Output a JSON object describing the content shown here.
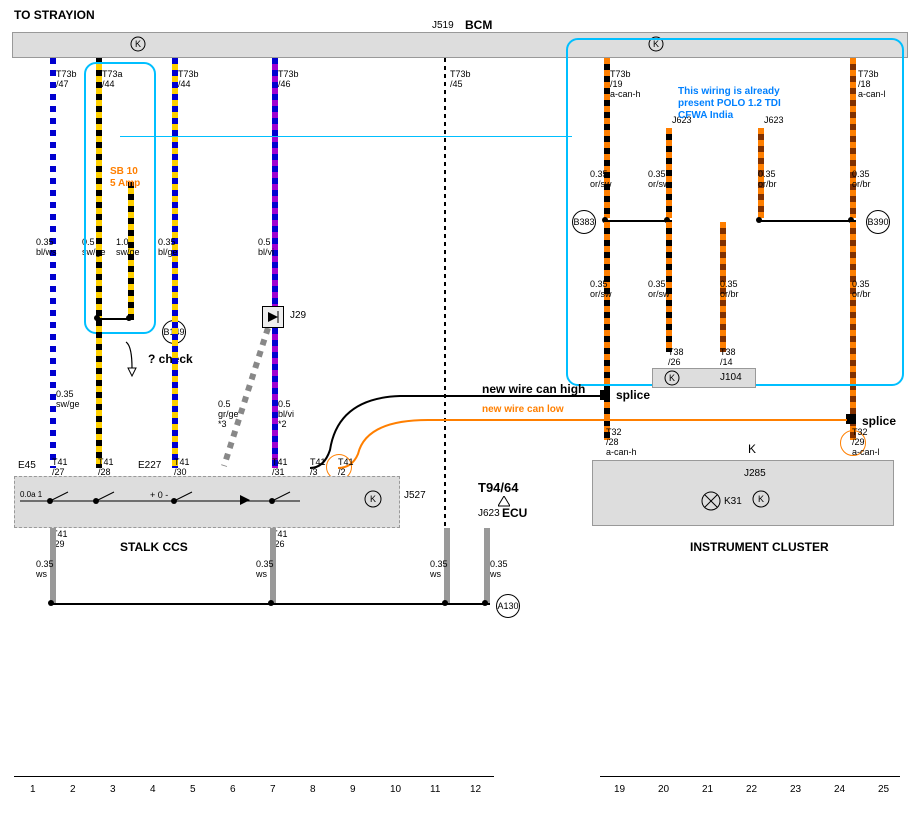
{
  "title_left": "TO STRAYION",
  "title_bcm": "BCM",
  "bcm_code": "J519",
  "note_blue": "This wiring is already present POLO 1.2 TDI CFWA India",
  "fuse": {
    "name": "SB 10",
    "rating": "5 Amp"
  },
  "check_note": "? check",
  "new_wire_high": "new wire can high",
  "new_wire_low": "new wire can low",
  "splice_label": "splice",
  "ecu": {
    "pin": "T94/64",
    "code": "J623",
    "name": "ECU"
  },
  "stalk": "STALK CCS",
  "cluster": "INSTRUMENT CLUSTER",
  "k_label": "K",
  "j285": "J285",
  "k31": "K31",
  "j527": "J527",
  "j104": "J104",
  "j29": "J29",
  "e45": "E45",
  "e227": "E227",
  "a130": "A130",
  "b149": "B149",
  "b383": "B383",
  "b390": "B390",
  "pins": {
    "t73b_47": "T73b\n/47",
    "t73a_44": "T73a\n/44",
    "t73b_44": "T73b\n/44",
    "t73b_46": "T73b\n/46",
    "t73b_45": "T73b\n/45",
    "t73b_19": "T73b\n/19\na-can-h",
    "t73b_18": "T73b\n/18\na-can-l",
    "j623_top1": "J623",
    "j623_top2": "J623",
    "t38_26": "T38\n/26",
    "t38_14": "T38\n/14",
    "t32_28": "T32\n/28\na-can-h",
    "t32_29": "T32\n/29\na-can-l",
    "t41_27": "T41\n/27",
    "t41_28": "T41\n/28",
    "t41_30": "T41\n/30",
    "t41_31": "T41\n/31",
    "t41_3": "T41\n/3",
    "t41_2": "T41\n/2",
    "t41_29": "T41\n/29",
    "t41_26": "T41\n/26"
  },
  "wires": {
    "w1": "0.35\nbl/ws",
    "w2": "0.5\nsw/ge",
    "w3": "1.0\nsw/ge",
    "w4": "0.35\nbl/ge",
    "w5": "0.5\nbl/vi",
    "w6": "0.35\nor/sw",
    "w7": "0.35\nor/sw",
    "w8": "0.35\nor/br",
    "w9": "0.35\nor/br",
    "w10": "0.35\nor/sw",
    "w11": "0.35\nor/sw",
    "w12": "0.35\nor/br",
    "w13": "0.35\nor/br",
    "w14": "0.35\nsw/ge",
    "w15": "0.5\ngr/ge\n*3",
    "w16": "0.5\nbl/vi\n*2",
    "w17": "0.35\nws",
    "w18": "0.35\nws",
    "w19": "0.35\nws",
    "w20": "0.35\nws"
  },
  "stalk_sw": "0.0a 1",
  "ruler_left": [
    "1",
    "2",
    "3",
    "4",
    "5",
    "6",
    "7",
    "8",
    "9",
    "10",
    "11",
    "12"
  ],
  "ruler_right": [
    "19",
    "20",
    "21",
    "22",
    "23",
    "24",
    "25"
  ]
}
